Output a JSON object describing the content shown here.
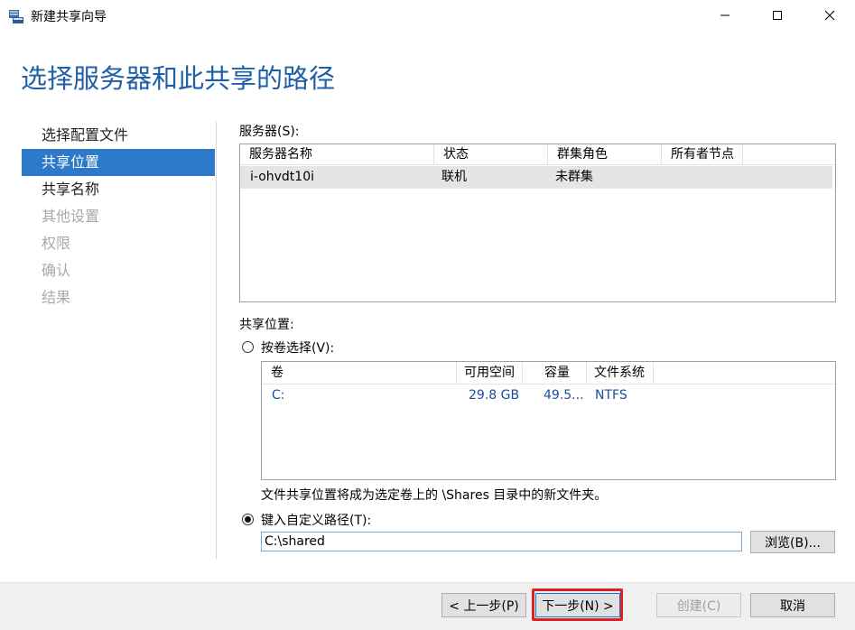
{
  "window": {
    "title": "新建共享向导"
  },
  "wizard": {
    "heading": "选择服务器和此共享的路径"
  },
  "nav": {
    "items": [
      {
        "label": "选择配置文件",
        "state": "normal"
      },
      {
        "label": "共享位置",
        "state": "active"
      },
      {
        "label": "共享名称",
        "state": "normal"
      },
      {
        "label": "其他设置",
        "state": "disabled"
      },
      {
        "label": "权限",
        "state": "disabled"
      },
      {
        "label": "确认",
        "state": "disabled"
      },
      {
        "label": "结果",
        "state": "disabled"
      }
    ]
  },
  "servers": {
    "label": "服务器(S):",
    "columns": [
      "服务器名称",
      "状态",
      "群集角色",
      "所有者节点"
    ],
    "rows": [
      {
        "name": "i-ohvdt10i",
        "status": "联机",
        "cluster_role": "未群集",
        "owner_node": ""
      }
    ]
  },
  "share_location": {
    "label": "共享位置:",
    "by_volume_label": "按卷选择(V):",
    "volume_columns": [
      "卷",
      "可用空间",
      "容量",
      "文件系统"
    ],
    "volumes": [
      {
        "volume": "C:",
        "free": "29.8 GB",
        "capacity": "49.5...",
        "fs": "NTFS"
      }
    ],
    "note": "文件共享位置将成为选定卷上的 \\Shares 目录中的新文件夹。",
    "custom_path_label": "键入自定义路径(T):",
    "custom_path_value": "C:\\shared",
    "browse_label": "浏览(B)..."
  },
  "footer": {
    "back_label": "< 上一步(P)",
    "next_label": "下一步(N) >",
    "create_label": "创建(C)",
    "cancel_label": "取消"
  },
  "colors": {
    "accent": "#2c7ac9",
    "heading": "#1f5fa8",
    "highlight": "#e0201c",
    "volume_text": "#1a4f9c"
  }
}
